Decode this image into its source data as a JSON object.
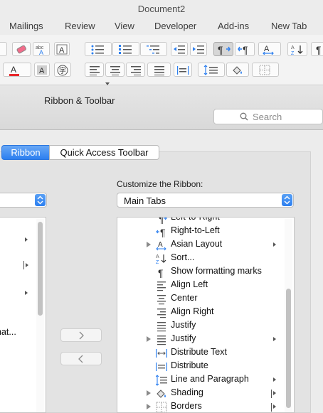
{
  "window": {
    "title": "Document2"
  },
  "tabs": [
    "Mailings",
    "Review",
    "View",
    "Developer",
    "Add-ins",
    "New Tab"
  ],
  "colors": {
    "accent": "#2c7ff0",
    "font_color_swatch": "#e8282b"
  },
  "ribbon_row1_icons": [
    "eraser-icon",
    "abc-spelling-icon",
    "text-box-A-icon",
    "bullets-icon",
    "numbering-icon",
    "multilevel-list-icon",
    "decrease-indent-icon",
    "increase-indent-icon",
    "ltr-paragraph-icon",
    "rtl-paragraph-icon",
    "asian-layout-icon",
    "sort-icon",
    "pilcrow-icon"
  ],
  "ribbon_row2_icons": [
    "font-color-icon",
    "character-shading-icon",
    "enclose-character-icon",
    "align-left-icon",
    "center-icon",
    "align-right-icon",
    "justify-icon",
    "distribute-icon",
    "line-spacing-icon",
    "shading-icon",
    "borders-icon"
  ],
  "dialog": {
    "title": "Ribbon & Toolbar",
    "search_placeholder": "Search",
    "segments": {
      "ribbon": "Ribbon",
      "qat": "Quick Access Toolbar"
    },
    "customize_label": "Customize the Ribbon:",
    "customize_select": "Main Tabs",
    "left_partial_item": "nat...",
    "ribbon_items": [
      {
        "label": "Left-to-Right",
        "icon": "ltr-icon",
        "disclosure": false,
        "submenu": "none"
      },
      {
        "label": "Right-to-Left",
        "icon": "rtl-icon",
        "disclosure": false,
        "submenu": "none"
      },
      {
        "label": "Asian Layout",
        "icon": "asian-layout-icon",
        "disclosure": true,
        "submenu": "arrow"
      },
      {
        "label": "Sort...",
        "icon": "sort-icon",
        "disclosure": false,
        "submenu": "none"
      },
      {
        "label": "Show formatting marks",
        "icon": "pilcrow-icon",
        "disclosure": false,
        "submenu": "none"
      },
      {
        "label": "Align Left",
        "icon": "align-left-icon",
        "disclosure": false,
        "submenu": "none"
      },
      {
        "label": "Center",
        "icon": "center-icon",
        "disclosure": false,
        "submenu": "none"
      },
      {
        "label": "Align Right",
        "icon": "align-right-icon",
        "disclosure": false,
        "submenu": "none"
      },
      {
        "label": "Justify",
        "icon": "justify-icon",
        "disclosure": false,
        "submenu": "none"
      },
      {
        "label": "Justify",
        "icon": "justify-icon",
        "disclosure": true,
        "submenu": "arrow"
      },
      {
        "label": "Distribute Text",
        "icon": "distribute-text-icon",
        "disclosure": false,
        "submenu": "none"
      },
      {
        "label": "Distribute",
        "icon": "distribute-icon",
        "disclosure": false,
        "submenu": "none"
      },
      {
        "label": "Line and Paragraph",
        "icon": "line-spacing-icon",
        "disclosure": false,
        "submenu": "arrow"
      },
      {
        "label": "Shading",
        "icon": "shading-icon",
        "disclosure": true,
        "submenu": "bar"
      },
      {
        "label": "Borders",
        "icon": "borders-icon",
        "disclosure": true,
        "submenu": "bar"
      }
    ]
  }
}
